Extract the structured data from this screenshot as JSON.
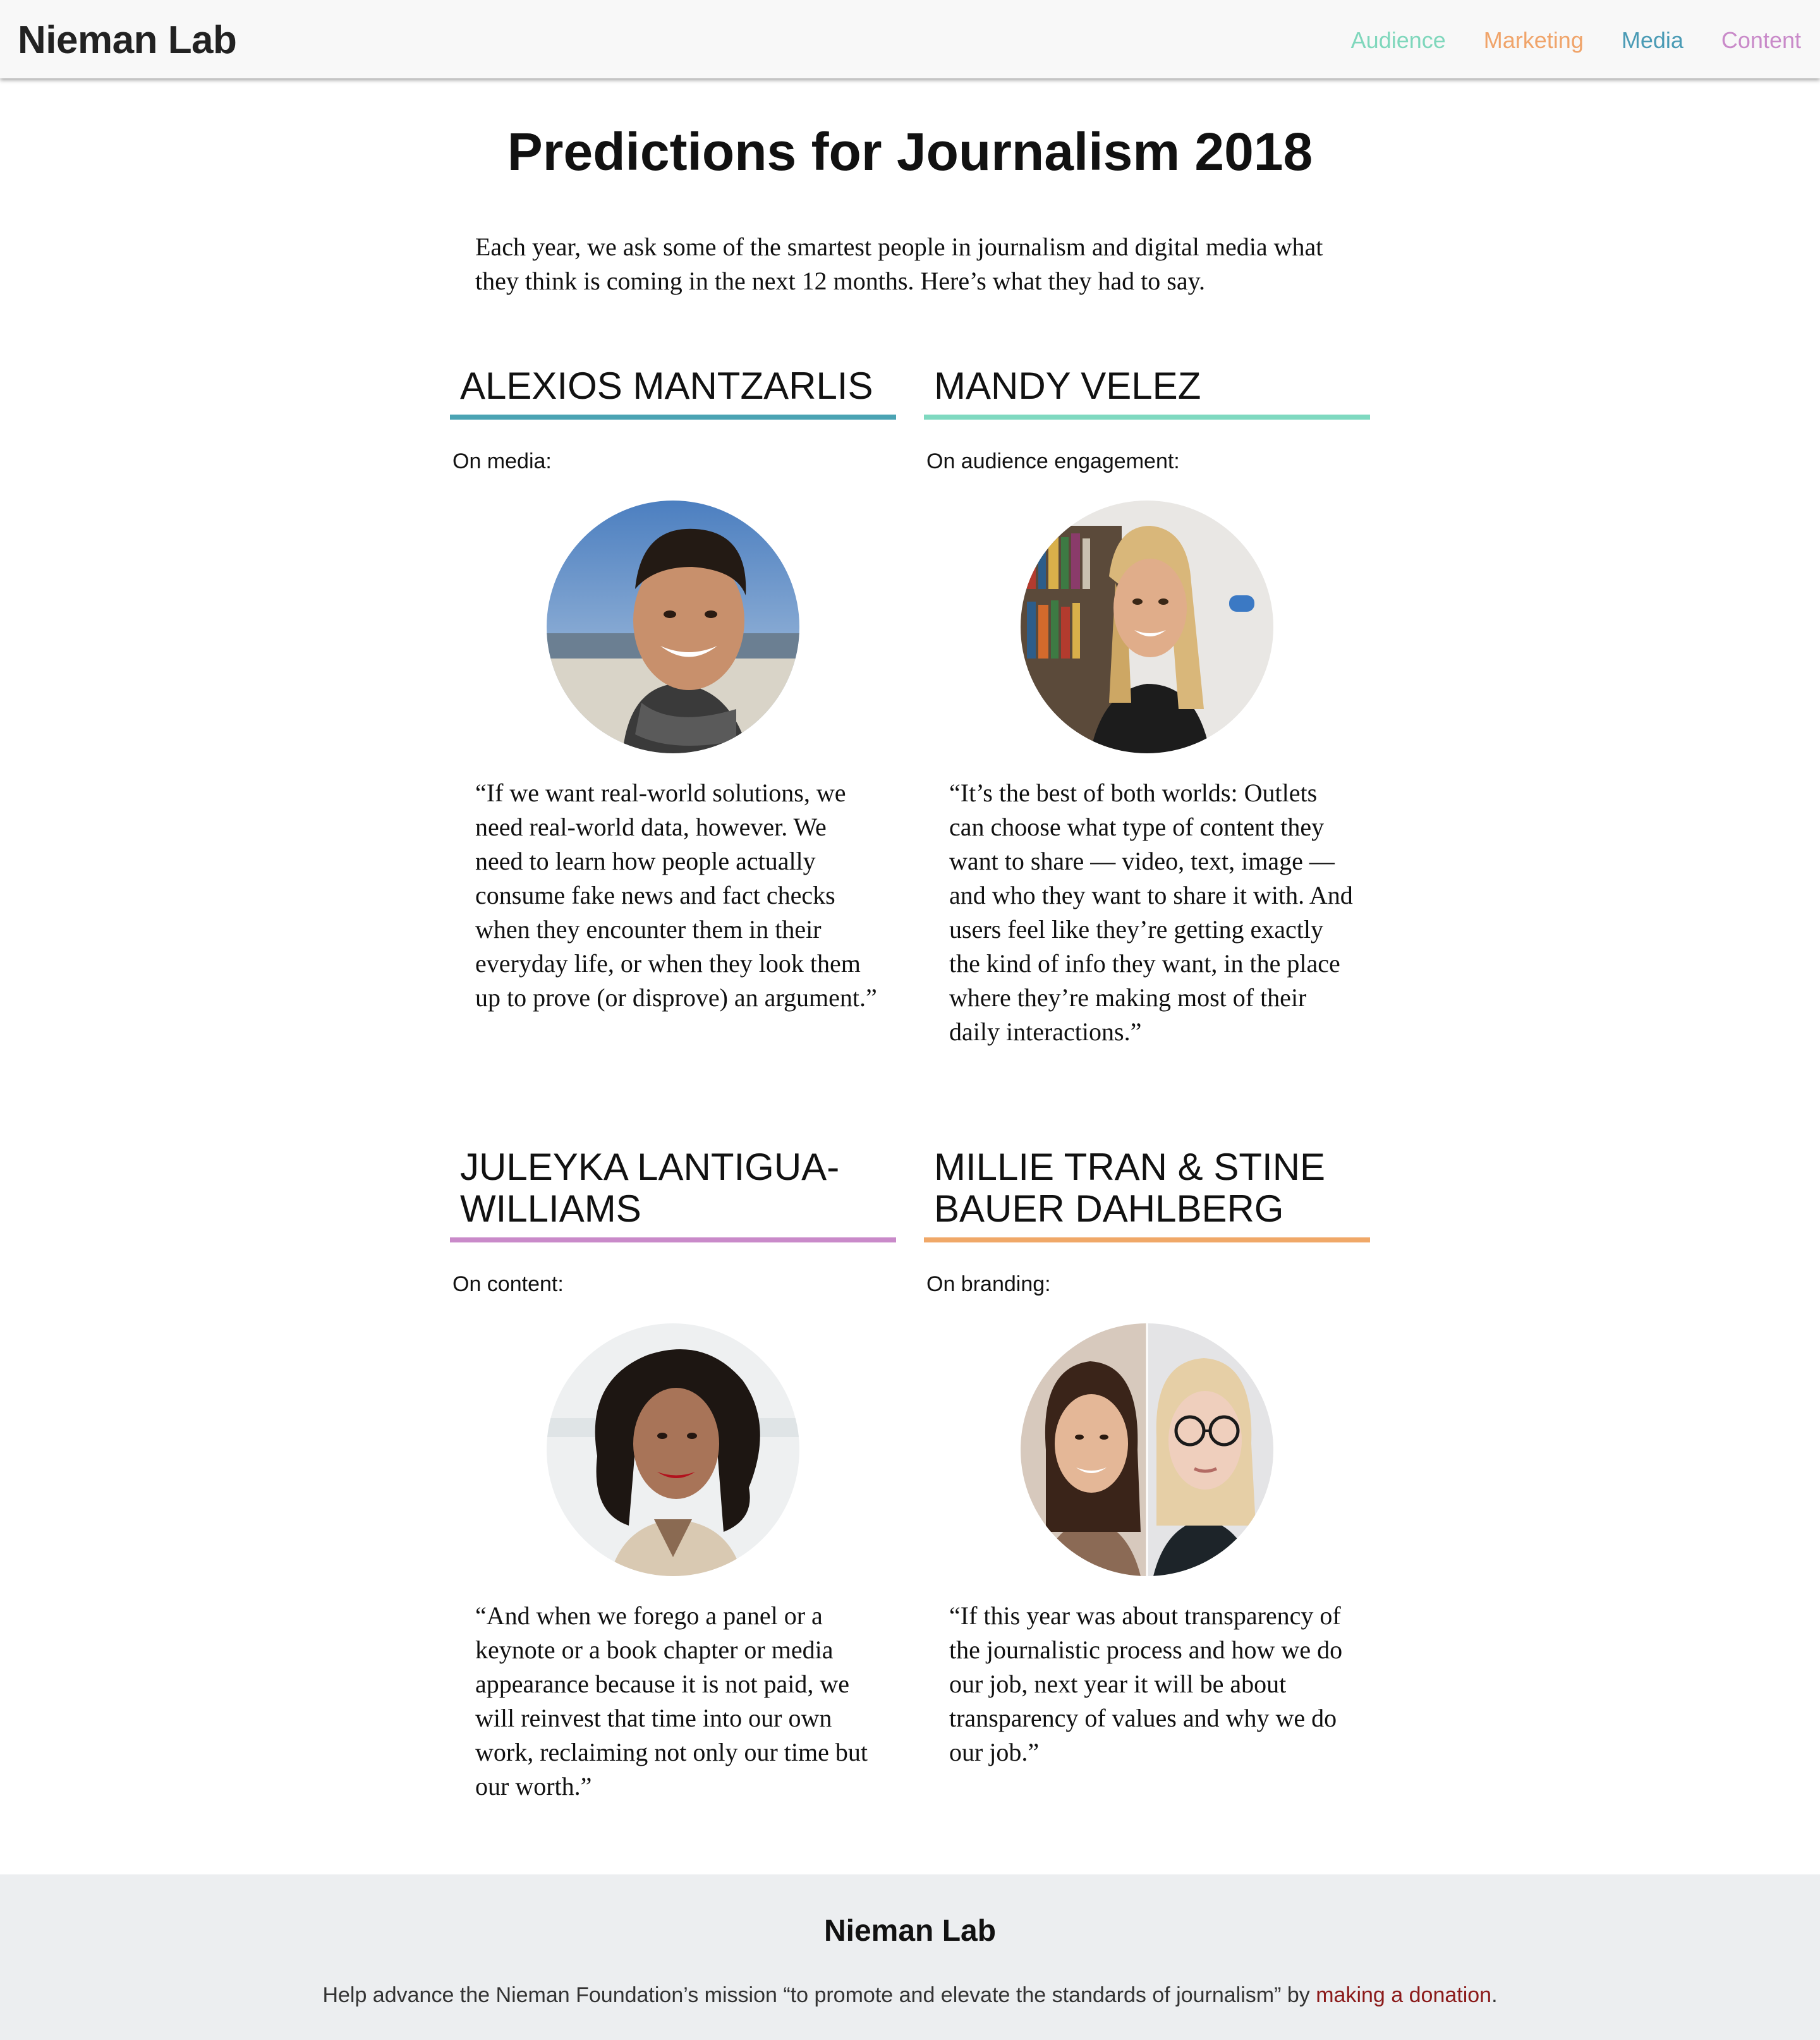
{
  "header": {
    "brand": "Nieman Lab",
    "nav": [
      {
        "label": "Audience",
        "color": "#7fd7bc"
      },
      {
        "label": "Marketing",
        "color": "#f0a46a"
      },
      {
        "label": "Media",
        "color": "#4a9bb5"
      },
      {
        "label": "Content",
        "color": "#c98ac9"
      }
    ]
  },
  "main": {
    "title": "Predictions for Journalism 2018",
    "intro": "Each year, we ask some of the smartest people in journalism and digital media what they think is coming in the next 12 months. Here’s what they had to say.",
    "cards": [
      {
        "name": "Alexios Mantzarlis",
        "topic": "On media:",
        "accent": "#4aa3b3",
        "portrait": "portrait-alexios",
        "quote": "“If we want real-world solutions, we need real-world data, however. We need to learn how people actually consume fake news and fact checks when they encounter them in their everyday life, or when they look them up to prove (or disprove) an argument.”"
      },
      {
        "name": "Mandy Velez",
        "topic": "On audience engagement:",
        "accent": "#7fd9c0",
        "portrait": "portrait-mandy",
        "quote": "“It’s the best of both worlds: Outlets can choose what type of content they want to share — video, text, image — and who they want to share it with. And users feel like they’re getting exactly the kind of info they want, in the place where they’re making most of their daily interactions.”"
      },
      {
        "name": "Juleyka Lantigua-Williams",
        "topic": "On content:",
        "accent": "#c98ac9",
        "portrait": "portrait-juleyka",
        "quote": "“And when we forego a panel or a keynote or a book chapter or media appearance because it is not paid, we will reinvest that time into our own work, reclaiming not only our time but our worth.”"
      },
      {
        "name": "Millie Tran & Stine Bauer Dahlberg",
        "topic": "On branding:",
        "accent": "#f0a868",
        "portrait": "portrait-millie-stine",
        "quote": "“If this year was about transparency of the journalistic process and how we do our job, next year it will be about transparency of values and why we do our job.”"
      }
    ]
  },
  "footer": {
    "brand": "Nieman Lab",
    "text_before": "Help advance the Nieman Foundation’s mission “to promote and elevate the standards of journalism” by ",
    "link_label": "making a donation",
    "text_after": "."
  }
}
